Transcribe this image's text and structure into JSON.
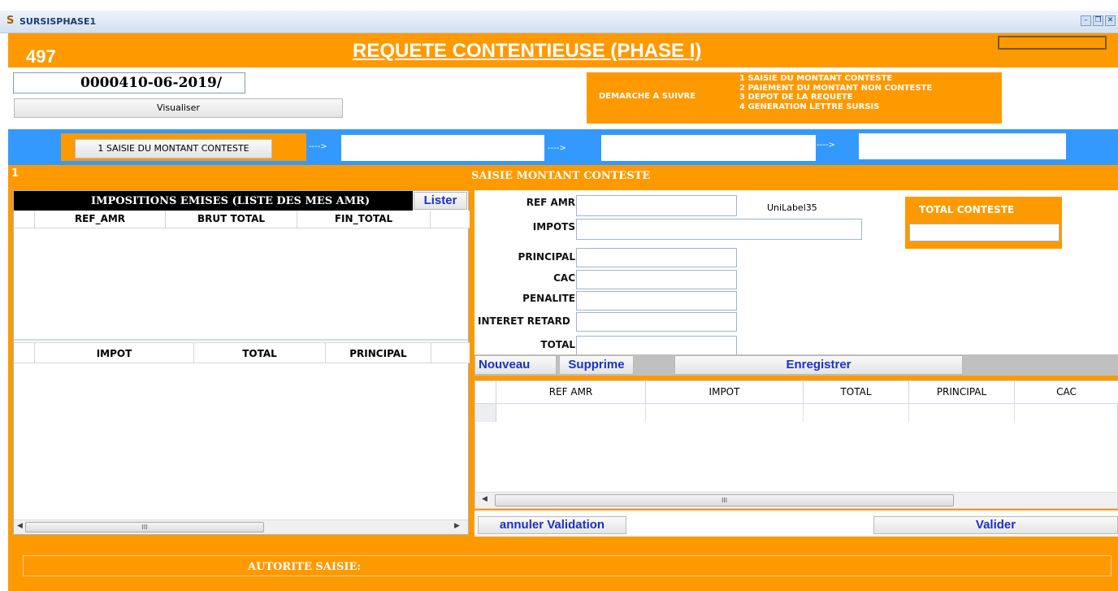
{
  "window": {
    "title": "SURSISPHASE1",
    "controls": [
      "minimize-icon",
      "restore-icon",
      "close-icon"
    ]
  },
  "header": {
    "number": "497",
    "title": "REQUETE CONTENTIEUSE (PHASE I)",
    "reference": "0000410-06-2019/",
    "visualiser_label": "Visualiser"
  },
  "demarche": {
    "label": "DEMARCHE A SUIVRE",
    "steps": [
      "1 SAISIE DU MONTANT CONTESTE",
      "2 PAIEMENT DU MONTANT NON CONTESTE",
      "3 DEPOT DE LA REQUETE",
      "4 GENERATION LETTRE SURSIS"
    ]
  },
  "workflow": {
    "step1_label": "1 SAISIE DU MONTANT CONTESTE",
    "arrow": "---->"
  },
  "section": {
    "number": "1",
    "title": "SAISIE MONTANT CONTESTE"
  },
  "left_panel": {
    "title": "IMPOSITIONS EMISES (LISTE DES MES AMR)",
    "lister_label": "Lister",
    "grid1_columns": [
      "REF_AMR",
      "BRUT TOTAL",
      "FIN_TOTAL"
    ],
    "grid2_columns": [
      "IMPOT",
      "TOTAL",
      "PRINCIPAL"
    ],
    "scroll_thumb_glyph": "III"
  },
  "form": {
    "ref_amr_label": "REF AMR",
    "impots_label": "IMPOTS",
    "principal_label": "PRINCIPAL",
    "cac_label": "CAC",
    "penalite_label": "PENALITE",
    "interet_label": "INTERET RETARD",
    "total_label": "TOTAL",
    "unilabel": "UniLabel35",
    "total_conteste_label": "TOTAL CONTESTE"
  },
  "actions": {
    "nouveau": "Nouveau",
    "supprime": "Supprime",
    "enregistrer": "Enregistrer",
    "annuler": "annuler Validation",
    "valider": "Valider"
  },
  "right_grid": {
    "columns": [
      "REF AMR",
      "IMPOT",
      "TOTAL",
      "PRINCIPAL",
      "CAC"
    ],
    "scroll_thumb_glyph": "III"
  },
  "footer": {
    "autorite_label": "AUTORITE SAISIE:"
  },
  "colors": {
    "accent_orange": "#ff9900",
    "accent_blue": "#3399ff",
    "link_blue": "#1a32c8"
  }
}
